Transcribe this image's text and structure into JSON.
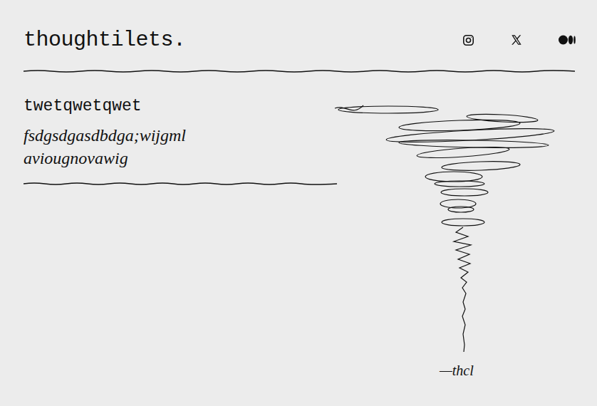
{
  "brand": "thoughtilets.",
  "post": {
    "title": "twetqwetqwet",
    "body": "fsdgsdgasdbdga;wijgml aviougnovawig"
  },
  "signature": "—thcl"
}
